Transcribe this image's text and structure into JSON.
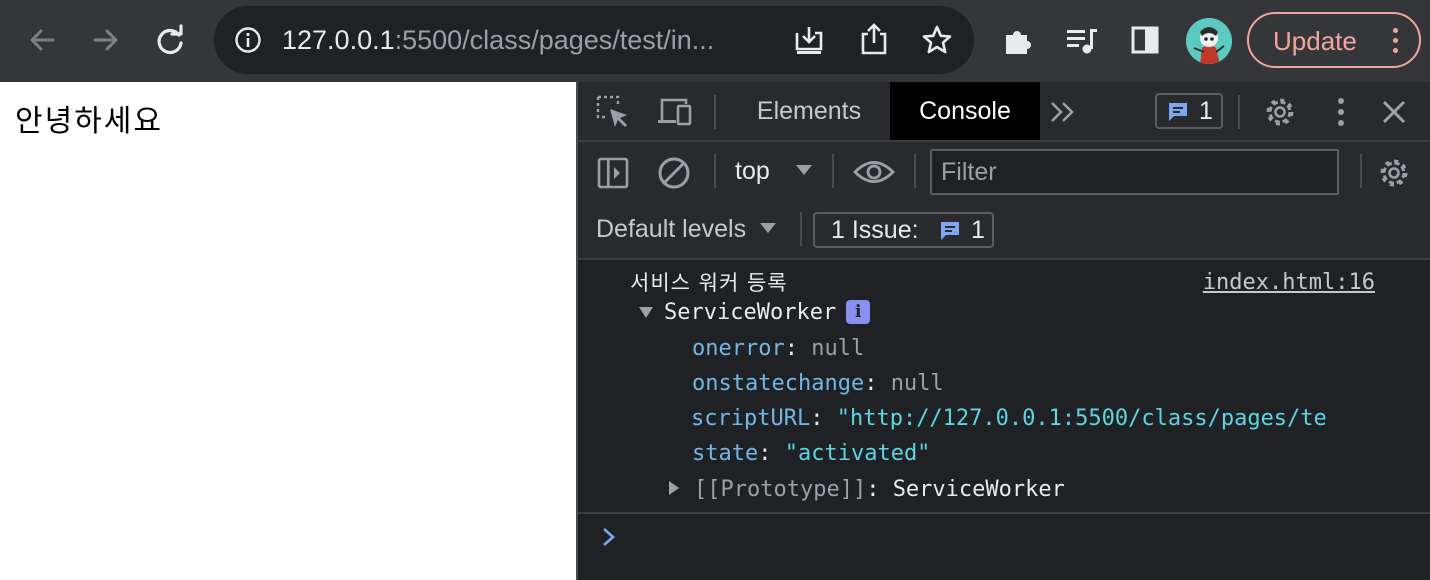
{
  "browser": {
    "url_host": "127.0.0.1",
    "url_rest": ":5500/class/pages/test/in...",
    "update_label": "Update"
  },
  "page": {
    "greeting": "안녕하세요"
  },
  "devtools": {
    "tabs": [
      {
        "label": "Elements",
        "active": false
      },
      {
        "label": "Console",
        "active": true
      }
    ],
    "issues_count": "1",
    "context": "top",
    "filter_placeholder": "Filter",
    "levels_label": "Default levels",
    "issue_label": "1 Issue:",
    "issue_count": "1",
    "console": {
      "message": "서비스 워커 등록",
      "source": "index.html:16",
      "object_name": "ServiceWorker",
      "info_glyph": "i",
      "props": [
        {
          "key": "onerror",
          "sep": ":",
          "value": "null",
          "kind": "null"
        },
        {
          "key": "onstatechange",
          "sep": ":",
          "value": "null",
          "kind": "null"
        },
        {
          "key": "scriptURL",
          "sep": ":",
          "value": "\"http://127.0.0.1:5500/class/pages/te",
          "kind": "string"
        },
        {
          "key": "state",
          "sep": ":",
          "value": "\"activated\"",
          "kind": "string"
        }
      ],
      "prototype_key": "[[Prototype]]",
      "prototype_sep": ":",
      "prototype_value": "ServiceWorker"
    }
  },
  "colors": {
    "toolbar_bg": "#35363a",
    "devtools_bg": "#202124",
    "accent_update": "#f2a59e",
    "console_key": "#71b7e6",
    "console_string": "#5cd5e0"
  },
  "icons": [
    "back-arrow-icon",
    "forward-arrow-icon",
    "reload-icon",
    "site-info-icon",
    "install-icon",
    "share-icon",
    "bookmark-star-icon",
    "extensions-icon",
    "media-queue-icon",
    "side-panel-icon",
    "avatar",
    "kebab-menu-icon",
    "inspect-element-icon",
    "device-toolbar-icon",
    "more-tabs-icon",
    "message-icon",
    "settings-gear-icon",
    "more-vertical-icon",
    "close-icon",
    "sidebar-toggle-icon",
    "clear-console-icon",
    "eye-icon",
    "dropdown-arrow-icon"
  ]
}
